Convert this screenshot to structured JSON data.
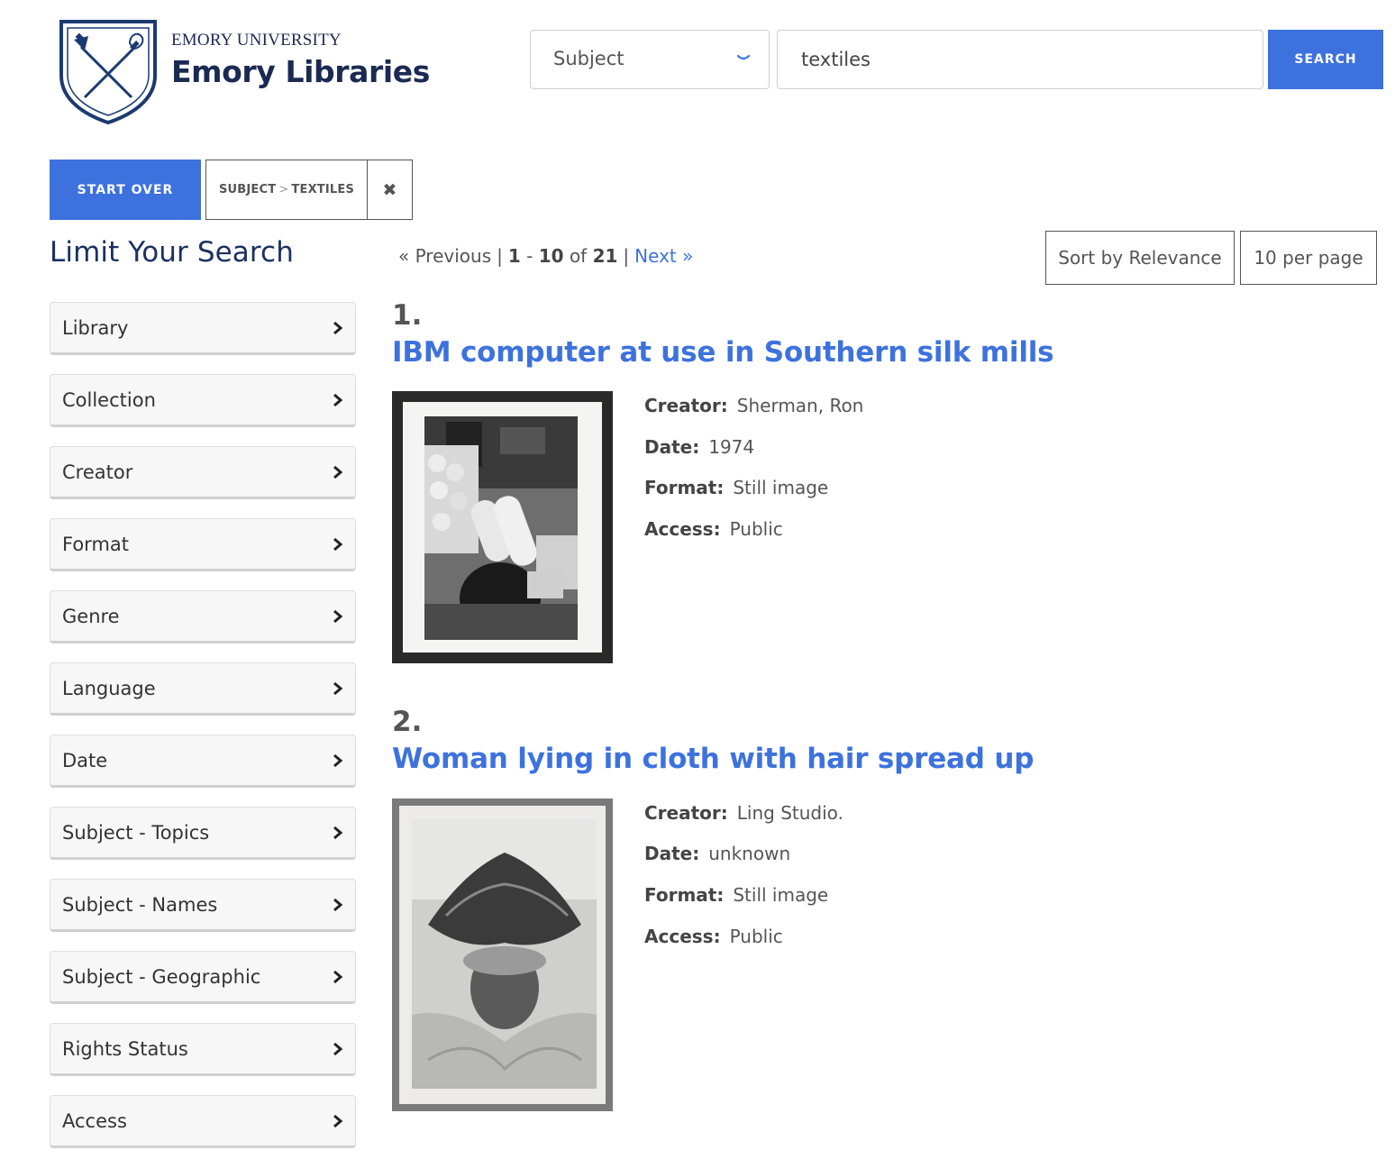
{
  "header": {
    "university": "EMORY UNIVERSITY",
    "library": "Emory Libraries",
    "search_field_selected": "Subject",
    "search_value": "textiles",
    "search_button": "SEARCH"
  },
  "constraints": {
    "start_over": "START OVER",
    "field": "SUBJECT",
    "separator": ">",
    "value": "TEXTILES",
    "remove_glyph": "✖"
  },
  "sidebar": {
    "heading": "Limit Your Search",
    "facets": [
      "Library",
      "Collection",
      "Creator",
      "Format",
      "Genre",
      "Language",
      "Date",
      "Subject - Topics",
      "Subject - Names",
      "Subject - Geographic",
      "Rights Status",
      "Access"
    ]
  },
  "pagination": {
    "previous": "« Previous",
    "start": "1",
    "dash": "-",
    "end": "10",
    "of": "of",
    "total": "21",
    "next": "Next »"
  },
  "sort": {
    "label": "Sort by Relevance"
  },
  "per_page": {
    "label": "10 per page"
  },
  "labels": {
    "creator": "Creator:",
    "date": "Date:",
    "format": "Format:",
    "access": "Access:"
  },
  "results": [
    {
      "number": "1.",
      "title": "IBM computer at use in Southern silk mills",
      "creator": "Sherman, Ron",
      "date": "1974",
      "format": "Still image",
      "access": "Public"
    },
    {
      "number": "2.",
      "title": "Woman lying in cloth with hair spread up",
      "creator": "Ling Studio.",
      "date": "unknown",
      "format": "Still image",
      "access": "Public"
    }
  ],
  "colors": {
    "accent": "#3d72de",
    "brand_navy": "#1b2a52",
    "heading_navy": "#1b3162",
    "facet_bg": "#f7f7f7"
  },
  "icons": [
    "emory-shield-logo-icon",
    "chevron-down-icon",
    "close-icon",
    "chevron-right-icon"
  ]
}
